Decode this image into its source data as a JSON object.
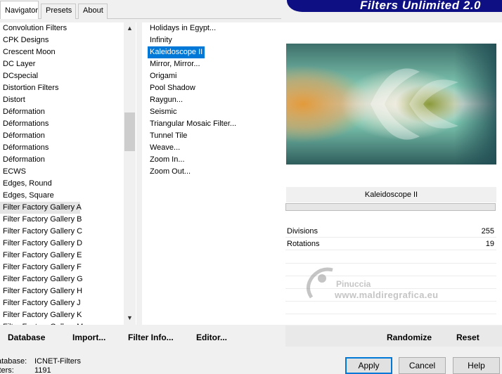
{
  "tabs": [
    {
      "label": "Navigator",
      "active": true
    },
    {
      "label": "Presets",
      "active": false
    },
    {
      "label": "About",
      "active": false
    }
  ],
  "banner_title": "Filters Unlimited 2.0",
  "categories": [
    "Convolution Filters",
    "CPK Designs",
    "Crescent Moon",
    "DC Layer",
    "DCspecial",
    "Distortion Filters",
    "Distort",
    "Déformation",
    "Déformations",
    "Déformation",
    "Déformations",
    "Déformation",
    "ECWS",
    "Edges, Round",
    "Edges, Square",
    "Filter Factory Gallery A",
    "Filter Factory Gallery B",
    "Filter Factory Gallery C",
    "Filter Factory Gallery D",
    "Filter Factory Gallery E",
    "Filter Factory Gallery F",
    "Filter Factory Gallery G",
    "Filter Factory Gallery H",
    "Filter Factory Gallery J",
    "Filter Factory Gallery K",
    "Filter Factory Gallery M"
  ],
  "selected_category_index": 15,
  "filters": [
    "Holidays in Egypt...",
    "Infinity",
    "Kaleidoscope II",
    "Mirror, Mirror...",
    "Origami",
    "Pool Shadow",
    "Raygun...",
    "Seismic",
    "Triangular Mosaic Filter...",
    "Tunnel Tile",
    "Weave...",
    "Zoom In...",
    "Zoom Out..."
  ],
  "selected_filter_index": 2,
  "selected_filter_name": "Kaleidoscope II",
  "params": [
    {
      "name": "Divisions",
      "value": "255"
    },
    {
      "name": "Rotations",
      "value": "19"
    }
  ],
  "watermark": {
    "line1": "Pinuccia",
    "line2": "www.maldiregrafica.eu"
  },
  "toolbar": {
    "database": "Database",
    "import": "Import...",
    "filter_info": "Filter Info...",
    "editor": "Editor...",
    "randomize": "Randomize",
    "reset": "Reset"
  },
  "status": {
    "database_label": "atabase:",
    "database_value": "ICNET-Filters",
    "filters_label": "lters:",
    "filters_value": "1191"
  },
  "buttons": {
    "apply": "Apply",
    "cancel": "Cancel",
    "help": "Help"
  },
  "colors": {
    "selection": "#0078d7",
    "banner": "#0e0f82"
  }
}
